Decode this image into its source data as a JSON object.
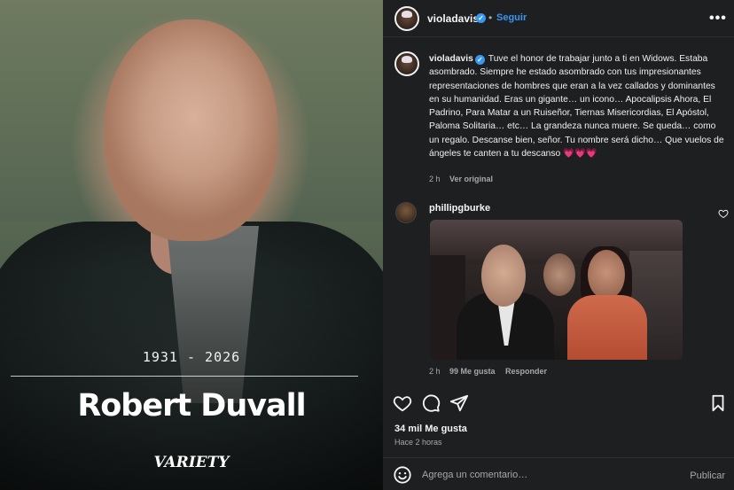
{
  "media": {
    "years": "1931 - 2026",
    "name": "Robert Duvall",
    "brand": "VARIETY"
  },
  "header": {
    "username": "violadavis",
    "separator": "•",
    "follow_label": "Seguir",
    "more_label": "•••"
  },
  "caption": {
    "username": "violadavis",
    "text": "Tuve el honor de trabajar junto a ti en Widows. Estaba asombrado. Siempre he estado asombrado con tus impresionantes representaciones de hombres que eran a la vez callados y dominantes en su humanidad. Eras un gigante… un icono… Apocalipsis Ahora, El Padrino, Para Matar a un Ruiseñor, Tiernas Misericordias, El Apóstol, Paloma Solitaria… etc… La grandeza nunca muere. Se queda… como un regalo. Descanse bien, señor. Tu nombre será dicho… Que vuelos de ángeles te canten a tu descanso",
    "hearts": "💗💗💗",
    "time": "2 h",
    "translation_link": "Ver original"
  },
  "comment": {
    "username": "phillipgburke",
    "time": "2 h",
    "likes": "99 Me gusta",
    "reply_label": "Responder"
  },
  "actions": {
    "likes_count": "34 mil Me gusta",
    "posted_ago": "Hace 2 horas"
  },
  "composer": {
    "placeholder": "Agrega un comentario…",
    "publish_label": "Publicar"
  },
  "colors": {
    "link_blue": "#3897f0",
    "panel_bg": "#1e1f21",
    "muted_text": "#a8a8a8",
    "heart_pink": "#e8447a"
  }
}
